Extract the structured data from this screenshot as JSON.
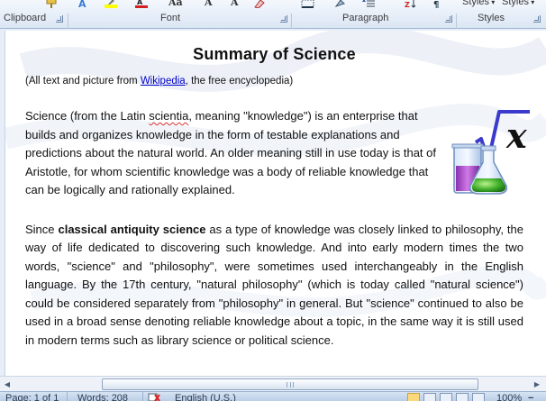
{
  "ribbon": {
    "groups": {
      "clipboard": "Clipboard",
      "font": "Font",
      "paragraph": "Paragraph",
      "styles": "Styles"
    },
    "styles_buttons": [
      "Styles",
      "Styles"
    ],
    "font_glyphs": {
      "grow": "Aa",
      "font_a": "A",
      "font_a2": "A"
    }
  },
  "document": {
    "title": "Summary of Science",
    "source": {
      "prefix": "(All text and picture from ",
      "link": "Wikipedia",
      "suffix": ", the free encyclopedia)"
    },
    "para1": {
      "before": "Science (from the Latin ",
      "latin": "scientia",
      "after": ", meaning \"knowledge\") is an enterprise that builds and organizes knowledge in the form of testable explanations and predictions about the natural world. An older meaning still in use today is that of Aristotle, for whom scientific knowledge was a body of reliable knowledge that can be logically and rationally explained."
    },
    "para2": {
      "before": "Since ",
      "bold": "classical antiquity science",
      "after": " as a type of knowledge was closely linked to philosophy, the way of life dedicated to discovering such knowledge. And into early modern times the two words, \"science\" and \"philosophy\", were sometimes used interchangeably in the English language. By the 17th century, \"natural philosophy\" (which is today called \"natural science\") could be considered separately from \"philosophy\" in general. But \"science\" continued to also be used in a broad sense denoting reliable knowledge about a topic, in the same way it is still used in modern terms such as library science or political science."
    },
    "icon": "science-flask-sqrt-x-icon"
  },
  "statusbar": {
    "page": "Page: 1 of 1",
    "words": "Words: 208",
    "language": "English (U.S.)",
    "zoom": "100%"
  },
  "colors": {
    "link": "#0000cc",
    "ribbon_bg": "#dbe6f4",
    "statusbar_bg": "#bccfe8"
  }
}
